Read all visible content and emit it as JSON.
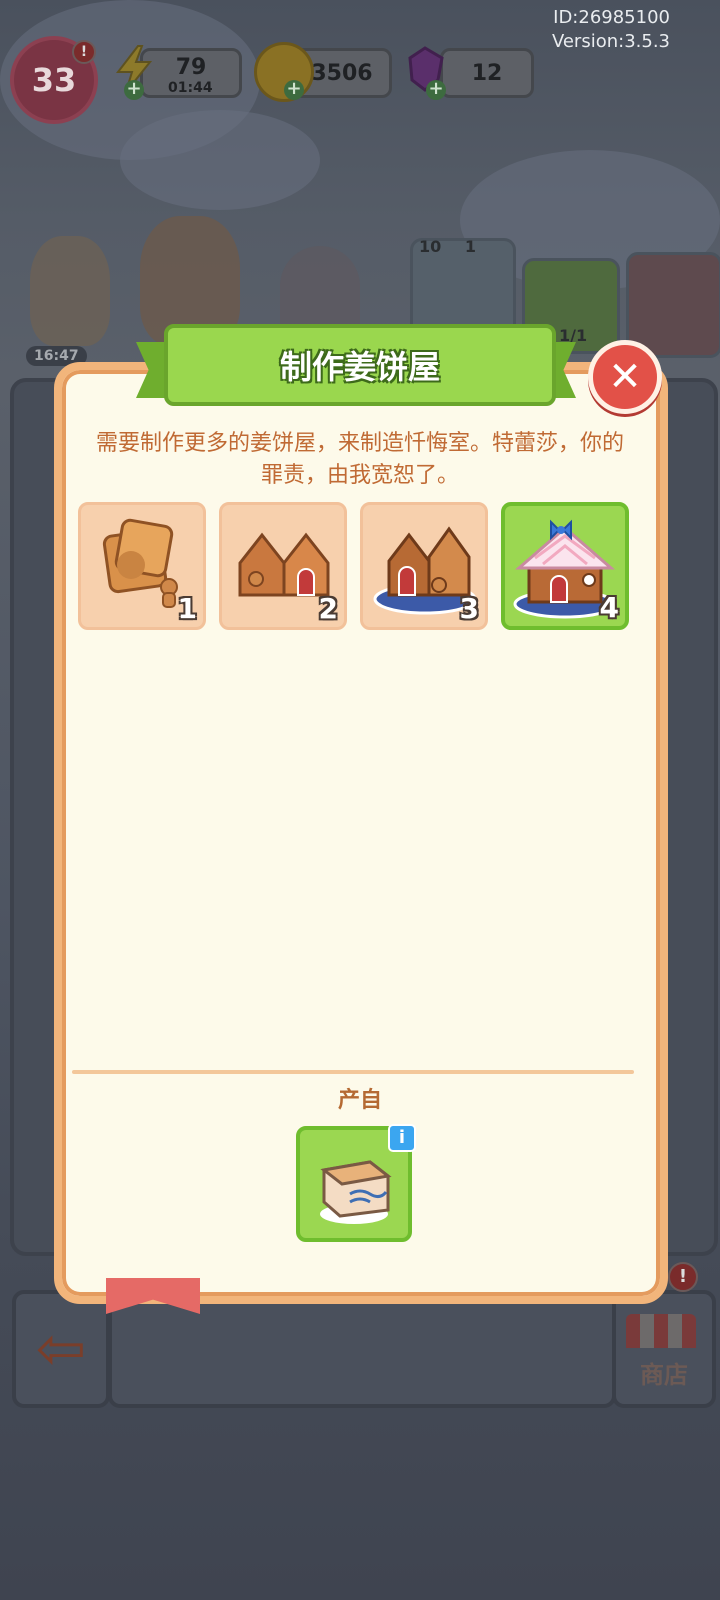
{
  "hud": {
    "id_text": "ID:26985100",
    "version_text": "Version:3.5.3",
    "level": "33",
    "energy": "79",
    "energy_timer": "01:44",
    "coins": "3506",
    "gems": "12",
    "alert": "!"
  },
  "background": {
    "slot_count_left": "10",
    "slot_count_right": "1",
    "card_progress": "1/1",
    "timer": "16:47",
    "shop_label": "商店"
  },
  "modal": {
    "title": "制作姜饼屋",
    "close_symbol": "✕",
    "description": "需要制作更多的姜饼屋，来制造忏悔室。特蕾莎，你的罪责，由我宽恕了。",
    "chain": [
      {
        "level": "1",
        "icon": "gingerbread-cookie-icon"
      },
      {
        "level": "2",
        "icon": "gingerbread-walls-icon"
      },
      {
        "level": "3",
        "icon": "gingerbread-frame-icon"
      },
      {
        "level": "4",
        "icon": "gingerbread-house-icon"
      }
    ],
    "source_label": "产自",
    "source_icon": "cardboard-box-icon",
    "info_symbol": "i"
  },
  "colors": {
    "modal_bg": "#fdfaea",
    "modal_border": "#f2b57b",
    "ribbon_green": "#9ad74e",
    "active_slot": "#9bd751",
    "inactive_slot": "#f7d0ad",
    "close_red": "#e25148",
    "desc_text": "#c06a34"
  }
}
